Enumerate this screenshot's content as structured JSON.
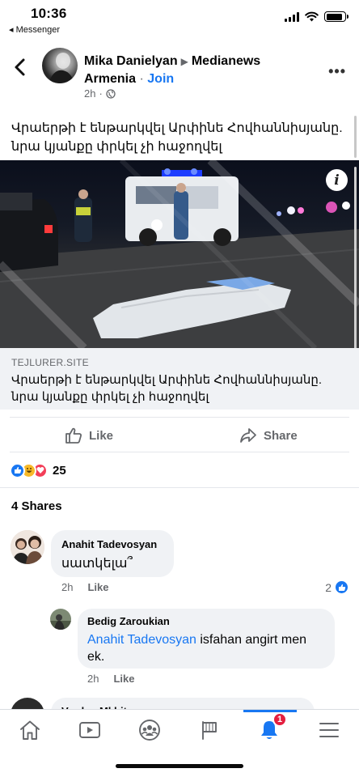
{
  "status_bar": {
    "time": "10:36",
    "back_app": "◂ Messenger",
    "battery_level": 0.9
  },
  "post": {
    "author": "Mika Danielyan",
    "group_line1": "Medianews",
    "group_line2": "Armenia",
    "join_label": "Join",
    "time_ago": "2h",
    "text": "Վրաերթի է ենթարկվել Արփինե Հովհաննիսյանը. նրա կյանքը փրկել չի հաջողվել",
    "link": {
      "domain": "TEJLURER.SITE",
      "title": "Վրաերթի է ենթարկվել Արփինե Հովհաննիսյանը. նրա կյանքը փրկել չի հաջողվել"
    }
  },
  "actions": {
    "like_label": "Like",
    "share_label": "Share"
  },
  "reactions": {
    "count": "25"
  },
  "shares_label": "4 Shares",
  "comments": [
    {
      "author": "Anahit Tadevosyan",
      "text": "սատկելա՞",
      "time": "2h",
      "like_label": "Like",
      "reaction_count": "2"
    },
    {
      "author": "Bedig Zaroukian",
      "mention": "Anahit Tadevosyan",
      "text": " isfahan angirt men ek.",
      "time": "2h",
      "like_label": "Like"
    },
    {
      "author": "Vardan Mkhitaryan"
    }
  ],
  "tab_bar": {
    "tabs": [
      {
        "icon": "home-icon"
      },
      {
        "icon": "watch-video-icon"
      },
      {
        "icon": "groups-icon"
      },
      {
        "icon": "pages-flag-icon"
      },
      {
        "icon": "notifications-bell-icon",
        "badge": "1"
      },
      {
        "icon": "menu-hamburger-icon"
      }
    ]
  },
  "colors": {
    "accent": "#1877f2",
    "badge": "#e41e3f",
    "bubble": "#f0f2f5",
    "secondary_text": "#65676b"
  }
}
